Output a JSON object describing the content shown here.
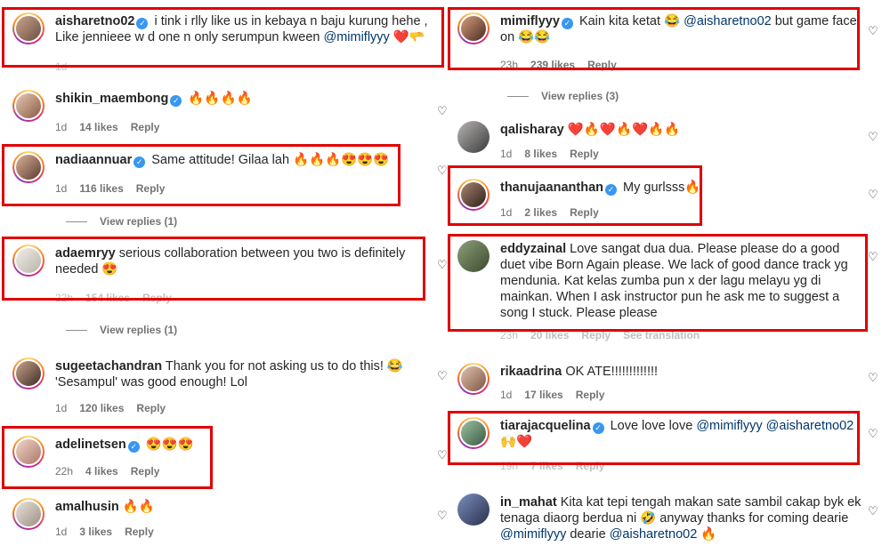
{
  "colors": {
    "highlight": "#e00000",
    "verified": "#3897f0",
    "mention": "#00376b",
    "meta": "#737373"
  },
  "left": {
    "c1": {
      "user": "aisharetno02",
      "text": "i tink i rlly like us in kebaya n baju kurung hehe , Like jennieee w d one n only serumpun kween",
      "mention": "@mimiflyyy",
      "emoji": "❤️🫳",
      "time": "1d"
    },
    "c2": {
      "user": "shikin_maembong",
      "text": "🔥🔥🔥🔥",
      "time": "1d",
      "likes": "14 likes",
      "reply": "Reply"
    },
    "c3": {
      "user": "nadiaannuar",
      "text": "Same attitude! Gilaa lah 🔥🔥🔥😍😍😍",
      "time": "1d",
      "likes": "116 likes",
      "reply": "Reply",
      "view_replies": "View replies (1)"
    },
    "c4": {
      "user": "adaemryy",
      "text": "serious collaboration between you two is definitely needed 😍",
      "time": "22h",
      "likes": "154 likes",
      "reply": "Reply",
      "view_replies": "View replies (1)"
    },
    "c5": {
      "user": "sugeetachandran",
      "text": "Thank you for not asking us to do this! 😂 'Sesampul' was good enough! Lol",
      "time": "1d",
      "likes": "120 likes",
      "reply": "Reply"
    },
    "c6": {
      "user": "adelinetsen",
      "text": "😍😍😍",
      "time": "22h",
      "likes": "4 likes",
      "reply": "Reply"
    },
    "c7": {
      "user": "amalhusin",
      "text": "🔥🔥",
      "time": "1d",
      "likes": "3 likes",
      "reply": "Reply"
    }
  },
  "right": {
    "c1": {
      "user": "mimiflyyy",
      "text_a": "Kain kita ketat 😂",
      "mention": "@aisharetno02",
      "text_b": "but game face on 😂😂",
      "time": "23h",
      "likes": "239 likes",
      "reply": "Reply",
      "view_replies": "View replies (3)"
    },
    "c2": {
      "user": "qalisharay",
      "text": "❤️🔥❤️🔥❤️🔥🔥",
      "time": "1d",
      "likes": "8 likes",
      "reply": "Reply"
    },
    "c3": {
      "user": "thanujaananthan",
      "text": "My gurlsss🔥",
      "time": "1d",
      "likes": "2 likes",
      "reply": "Reply"
    },
    "c4": {
      "user": "eddyzainal",
      "text": "Love sangat dua dua. Please please do a good duet vibe Born Again please. We lack of good dance track yg mendunia. Kat kelas zumba pun x der lagu melayu yg di mainkan. When I ask instructor pun he ask me to suggest a song I stuck. Please please",
      "time": "23h",
      "likes": "20 likes",
      "reply": "Reply",
      "translation": "See translation"
    },
    "c5": {
      "user": "rikaadrina",
      "text": "OK ATE!!!!!!!!!!!!!",
      "time": "1d",
      "likes": "17 likes",
      "reply": "Reply"
    },
    "c6": {
      "user": "tiarajacquelina",
      "text": "Love love love",
      "mention1": "@mimiflyyy",
      "mention2": "@aisharetno02",
      "emoji": "🙌❤️",
      "time": "19h",
      "likes": "7 likes",
      "reply": "Reply"
    },
    "c7": {
      "user": "in_mahat",
      "text": "Kita kat tepi tengah makan sate sambil cakap byk ek tenaga diaorg berdua ni 🤣 anyway thanks for coming dearie",
      "mention1": "@mimiflyyy",
      "mid": "dearie",
      "mention2": "@aisharetno02",
      "emoji": "🔥"
    }
  },
  "icons": {
    "heart": "heart-outline-icon",
    "verified": "verified-badge-icon"
  }
}
